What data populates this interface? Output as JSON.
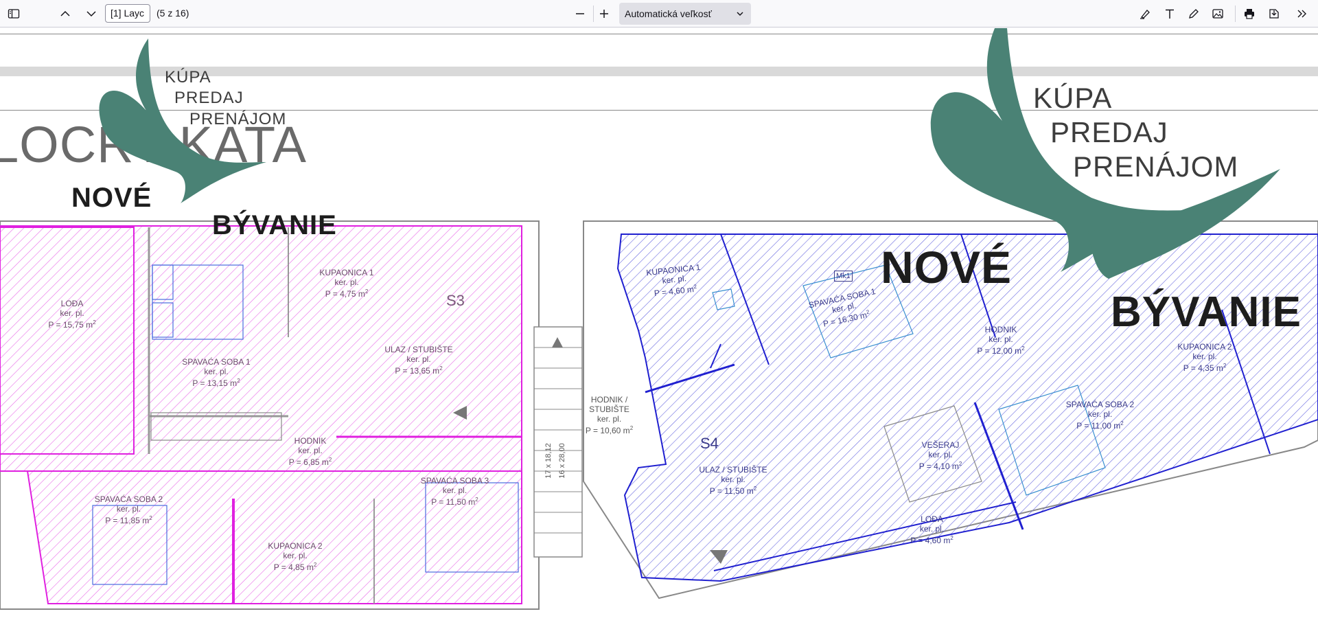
{
  "toolbar": {
    "page_value": "[1] Layc",
    "page_count": "(5 z 16)",
    "zoom_value": "Automatická veľkosť"
  },
  "plan": {
    "title": "LOCRT KATA",
    "unit_left": "S3",
    "unit_right": "S4",
    "rooms_left": [
      {
        "name": "LOĐA",
        "kind": "ker. pl.",
        "area": "P = 15,75 m"
      },
      {
        "name": "SPAVAĆA SOBA 1",
        "kind": "ker. pl.",
        "area": "P = 13,15 m"
      },
      {
        "name": "KUPAONICA 1",
        "kind": "ker. pl.",
        "area": "P = 4,75 m"
      },
      {
        "name": "ULAZ / STUBIŠTE",
        "kind": "ker. pl.",
        "area": "P = 13,65 m"
      },
      {
        "name": "HODNIK",
        "kind": "ker. pl.",
        "area": "P = 6,85 m"
      },
      {
        "name": "SPAVAĆA SOBA 2",
        "kind": "ker. pl.",
        "area": "P = 11,85 m"
      },
      {
        "name": "KUPAONICA 2",
        "kind": "ker. pl.",
        "area": "P = 4,85 m"
      },
      {
        "name": "SPAVAĆA SOBA 3",
        "kind": "ker. pl.",
        "area": "P = 11,50 m"
      }
    ],
    "corridor": {
      "name": "HODNIK /",
      "name2": "STUBIŠTE",
      "kind": "ker. pl.",
      "area": "P = 10,60 m"
    },
    "stair_dims": [
      "17 x 18,12",
      "16 x 28,00"
    ],
    "rooms_right": [
      {
        "name": "KUPAONICA 1",
        "kind": "ker. pl.",
        "area": "P = 4,60 m"
      },
      {
        "name": "SPAVAĆA SOBA 1",
        "kind": "ker. pl.",
        "area": "P = 16,30 m"
      },
      {
        "name": "HODNIK",
        "kind": "ker. pl.",
        "area": "P = 12,00 m"
      },
      {
        "name": "KUPAONICA 2",
        "kind": "ker. pl.",
        "area": "P = 4,35 m"
      },
      {
        "name": "SPAVAĆA SOBA 2",
        "kind": "ker. pl.",
        "area": "P = 11,00 m"
      },
      {
        "name": "VEŠERAJ",
        "kind": "ker. pl.",
        "area": "P = 4,10 m"
      },
      {
        "name": "ULAZ / STUBIŠTE",
        "kind": "ker. pl.",
        "area": "P = 11,50 m"
      },
      {
        "name": "LOĐA",
        "kind": "ker. pl.",
        "area": "P = 4,60 m"
      }
    ],
    "mk_label": "Mk1"
  },
  "watermark": {
    "line1": "KÚPA",
    "line2": "PREDAJ",
    "line3": "PRENÁJOM",
    "brand1": "NOVÉ",
    "brand2": "BÝVANIE",
    "color": "#4a8275"
  },
  "colors": {
    "pink": "#e020e0",
    "blue": "#2020d0"
  }
}
